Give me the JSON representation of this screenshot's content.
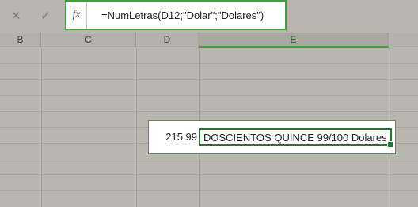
{
  "formula_bar": {
    "cancel_icon": "close-icon",
    "enter_icon": "check-icon",
    "fx_label": "fx",
    "formula": "=NumLetras(D12;\"Dolar\";\"Dolares\")"
  },
  "columns": [
    "B",
    "C",
    "D",
    "E"
  ],
  "active_column": "E",
  "cells": {
    "d12_value": "215.99",
    "e12_value": "DOSCIENTOS QUINCE 99/100 Dolares"
  },
  "colors": {
    "accent_green": "#3fa03a",
    "grid_bg": "#b9b6b1"
  }
}
